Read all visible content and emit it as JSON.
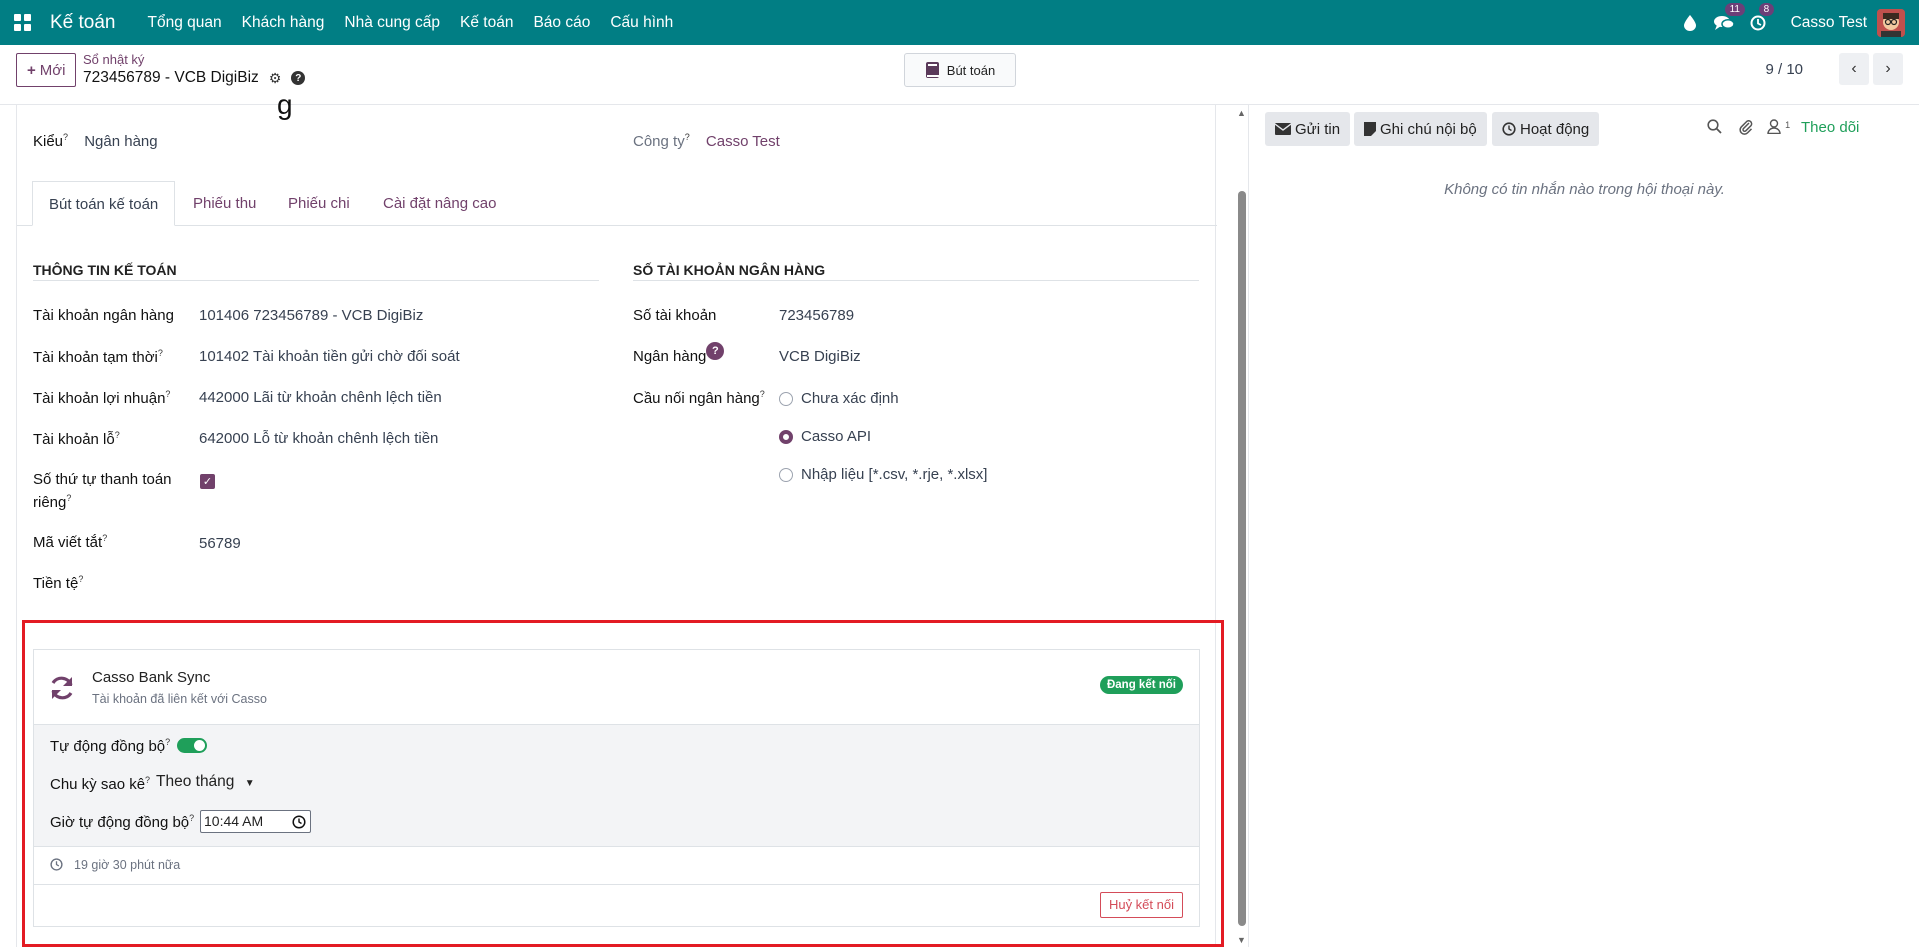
{
  "navbar": {
    "brand": "Kế toán",
    "menu": [
      "Tổng quan",
      "Khách hàng",
      "Nhà cung cấp",
      "Kế toán",
      "Báo cáo",
      "Cấu hình"
    ],
    "messages_count": "11",
    "activities_count": "8",
    "user": "Casso Test"
  },
  "control": {
    "new_label": "Mới",
    "breadcrumb_parent": "Sổ nhật ký",
    "breadcrumb_current": "723456789 - VCB DigiBiz",
    "journal_button": "Bút toán",
    "pager": "9 / 10"
  },
  "form": {
    "heading_partial": "g",
    "type_label": "Kiểu",
    "type_value": "Ngân hàng",
    "company_label": "Công ty",
    "company_value": "Casso Test",
    "tabs": [
      "Bút toán kế toán",
      "Phiếu thu",
      "Phiếu chi",
      "Cài đặt nâng cao"
    ],
    "accounting": {
      "title": "THÔNG TIN KẾ TOÁN",
      "bank_account_label": "Tài khoản ngân hàng",
      "bank_account_value": "101406 723456789 - VCB DigiBiz",
      "suspense_label": "Tài khoản tạm thời",
      "suspense_value": "101402 Tài khoản tiền gửi chờ đối soát",
      "profit_label": "Tài khoản lợi nhuận",
      "profit_value": "442000 Lãi từ khoản chênh lệch tiền",
      "loss_label": "Tài khoản lỗ",
      "loss_value": "642000 Lỗ từ khoản chênh lệch tiền",
      "sequence_label_1": "Số thứ tự thanh toán",
      "sequence_label_2": "riêng",
      "sequence_checked": true,
      "code_label": "Mã viết tắt",
      "code_value": "56789",
      "currency_label": "Tiền tệ"
    },
    "bank": {
      "title": "SỐ TÀI KHOẢN NGÂN HÀNG",
      "number_label": "Số tài khoản",
      "number_value": "723456789",
      "bank_label": "Ngân hàng",
      "bank_value": "VCB DigiBiz",
      "feeds_label": "Cầu nối ngân hàng",
      "feeds_options": [
        "Chưa xác định",
        "Casso API",
        "Nhập liệu [*.csv, *.rje, *.xlsx]"
      ],
      "feeds_selected": "Casso API"
    }
  },
  "sync": {
    "title": "Casso Bank Sync",
    "subtitle": "Tài khoản đã liên kết với Casso",
    "status": "Đang kết nối",
    "auto_sync_label": "Tự động đồng bộ",
    "auto_sync_on": true,
    "period_label": "Chu kỳ sao kê",
    "period_value": "Theo tháng",
    "time_label": "Giờ tự động đồng bộ",
    "time_value": "10:44 AM",
    "next_run": "19 giờ 30 phút nữa",
    "disconnect_label": "Huỷ kết nối"
  },
  "chatter": {
    "send_message": "Gửi tin",
    "log_note": "Ghi chú nội bộ",
    "activity": "Hoạt động",
    "followers_count": "1",
    "follow": "Theo dõi",
    "empty": "Không có tin nhắn nào trong hội thoại này."
  },
  "colors": {
    "navbar": "#017e84",
    "brand_purple": "#71416b",
    "success": "#1f9f5a",
    "danger": "#d44c59",
    "highlight": "#e31b23"
  }
}
